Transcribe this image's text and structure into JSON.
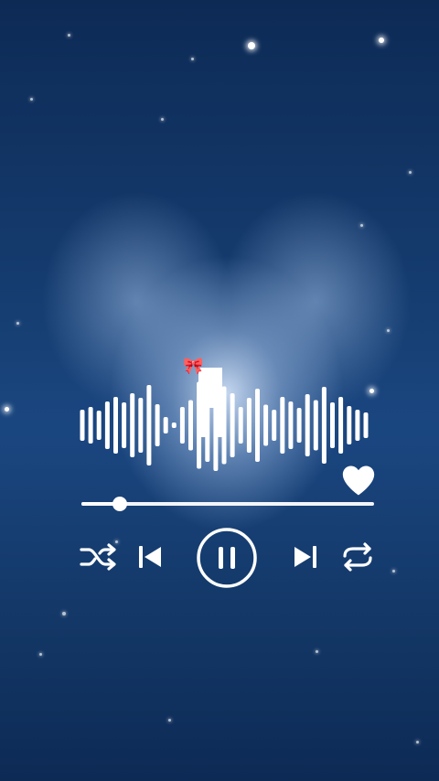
{
  "player": {
    "playing": true,
    "liked": true,
    "progress_fraction": 0.13,
    "waveform_levels": [
      0.34,
      0.4,
      0.32,
      0.52,
      0.62,
      0.5,
      0.7,
      0.6,
      0.88,
      0.46,
      0.18,
      0.06,
      0.4,
      0.55,
      0.95,
      0.8,
      1.0,
      0.85,
      0.7,
      0.4,
      0.6,
      0.8,
      0.45,
      0.34,
      0.62,
      0.52,
      0.38,
      0.68,
      0.55,
      0.84,
      0.5,
      0.62,
      0.42,
      0.34,
      0.28
    ],
    "controls": [
      "shuffle",
      "previous",
      "pause",
      "next",
      "repeat"
    ]
  },
  "colors": {
    "foreground": "#ffffff",
    "background": "#163e72"
  },
  "icons": {
    "decoration": "bow-icon",
    "like": "heart-icon"
  }
}
